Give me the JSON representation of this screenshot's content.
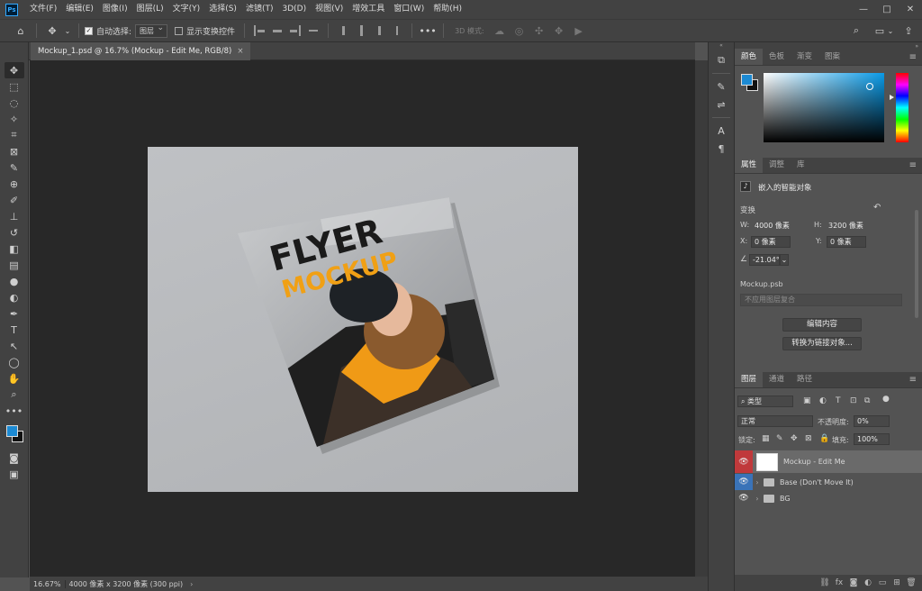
{
  "app": {
    "logo": "Ps"
  },
  "menu": [
    "文件(F)",
    "编辑(E)",
    "图像(I)",
    "图层(L)",
    "文字(Y)",
    "选择(S)",
    "滤镜(T)",
    "3D(D)",
    "视图(V)",
    "增效工具",
    "窗口(W)",
    "帮助(H)"
  ],
  "window_controls": [
    "—",
    "□",
    "✕"
  ],
  "options": {
    "auto_select_label": "自动选择:",
    "auto_select_target": "图层",
    "show_transform_label": "显示变换控件",
    "mode_3d_label": "3D 模式:"
  },
  "document_tab": {
    "title": "Mockup_1.psd @ 16.7% (Mockup - Edit Me, RGB/8)",
    "close": "×"
  },
  "mockup": {
    "headline_1": "FLYER",
    "headline_2": "MOCKUP",
    "headline_1_color": "#1b1b1b",
    "headline_2_color": "#f0a015"
  },
  "status": {
    "zoom": "16.67%",
    "info": "4000 像素 x 3200 像素 (300 ppi)",
    "arrow": "›"
  },
  "color_panel": {
    "tabs": [
      "颜色",
      "色板",
      "渐变",
      "图案"
    ],
    "foreground": "#1c8ad3",
    "background": "#111111"
  },
  "properties": {
    "tabs": [
      "属性",
      "调整",
      "库"
    ],
    "layer_type": "嵌入的智能对象",
    "transform_label": "变换",
    "w_label": "W:",
    "w_value": "4000 像素",
    "h_label": "H:",
    "h_value": "3200 像素",
    "x_label": "X:",
    "x_value": "0 像素",
    "y_label": "Y:",
    "y_value": "0 像素",
    "angle_value": "-21.04°",
    "file_name": "Mockup.psb",
    "comp_placeholder": "不应用图层复合",
    "edit_button": "编辑内容",
    "convert_button": "转换为链接对象..."
  },
  "layers": {
    "tabs": [
      "图层",
      "通道",
      "路径"
    ],
    "filter_label": "类型",
    "blend_mode": "正常",
    "opacity_label": "不透明度:",
    "opacity_value": "0%",
    "lock_label": "锁定:",
    "fill_label": "填充:",
    "fill_value": "100%",
    "items": [
      {
        "name": "Mockup - Edit Me"
      },
      {
        "name": "Base (Don't Move It)"
      },
      {
        "name": "BG"
      }
    ]
  }
}
